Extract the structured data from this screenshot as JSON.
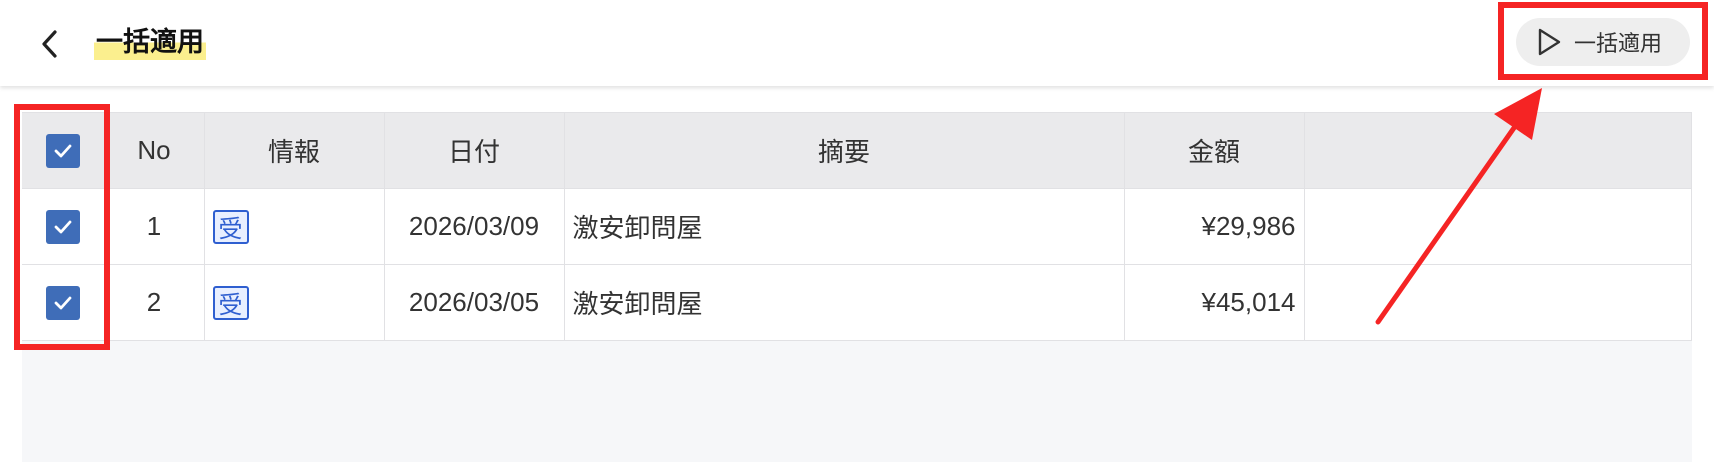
{
  "header": {
    "title": "一括適用",
    "back_icon": "chevron-left-icon",
    "apply_button": {
      "label": "一括適用",
      "icon": "play-outline-icon"
    }
  },
  "table": {
    "columns": [
      "No",
      "情報",
      "日付",
      "摘要",
      "金額",
      ""
    ],
    "select_all_checked": true,
    "rows": [
      {
        "checked": true,
        "no": "1",
        "info_badge": "受",
        "date": "2026/03/09",
        "summary": "激安卸問屋",
        "amount": "¥29,986"
      },
      {
        "checked": true,
        "no": "2",
        "info_badge": "受",
        "date": "2026/03/05",
        "summary": "激安卸問屋",
        "amount": "¥45,014"
      }
    ]
  },
  "colors": {
    "accent": "#3f6db8",
    "annotation": "#f52424",
    "title_highlight": "#fbef8e",
    "badge": "#2f5fd0"
  }
}
